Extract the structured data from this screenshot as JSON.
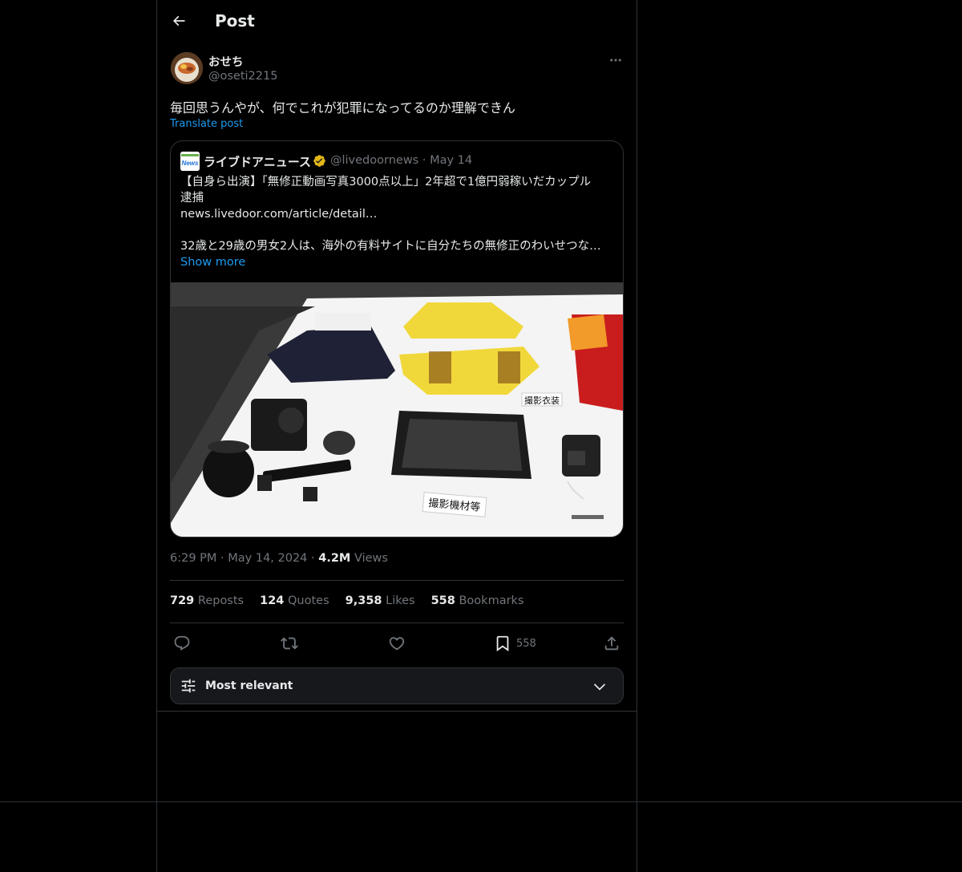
{
  "header": {
    "title": "Post"
  },
  "post": {
    "author_name": "おせち",
    "author_handle": "@oseti2215",
    "text": "毎回思うんやが、何でこれが犯罪になってるのか理解できん",
    "translate_label": "Translate post",
    "timestamp": "6:29 PM · May 14, 2024 ·",
    "views_count": "4.2M",
    "views_label": "Views"
  },
  "quote": {
    "logo_text": "News",
    "name": "ライブドアニュース",
    "handle": "@livedoornews · May 14",
    "line1": "【自身ら出演】「無修正動画写真3000点以上」2年超で1億円弱稼いだカップル",
    "line2": "逮捕",
    "link": "news.livedoor.com/article/detail…",
    "summary": "32歳と29歳の男女2人は、海外の有料サイトに自分たちの無修正のわいせつな…",
    "show_more": "Show more",
    "image_label_costume": "撮影衣装",
    "image_label_equipment": "撮影機材等"
  },
  "stats": {
    "reposts_count": "729",
    "reposts_label": "Reposts",
    "quotes_count": "124",
    "quotes_label": "Quotes",
    "likes_count": "9,358",
    "likes_label": "Likes",
    "bookmarks_count": "558",
    "bookmarks_label": "Bookmarks"
  },
  "actions": {
    "bookmark_count": "558"
  },
  "sort": {
    "label": "Most relevant"
  },
  "icons": {
    "back": "arrow-left-icon",
    "more": "more-horizontal-icon",
    "reply": "reply-icon",
    "repost": "repost-icon",
    "like": "heart-icon",
    "bookmark": "bookmark-icon",
    "share": "share-icon",
    "sort": "sliders-icon",
    "chevron": "chevron-down-icon",
    "verified": "verified-gold-badge-icon"
  },
  "colors": {
    "background": "#000000",
    "text": "#e7e9ea",
    "muted": "#71767b",
    "link": "#1d9bf0",
    "border": "#2f3336",
    "verified": "#e2b719"
  }
}
